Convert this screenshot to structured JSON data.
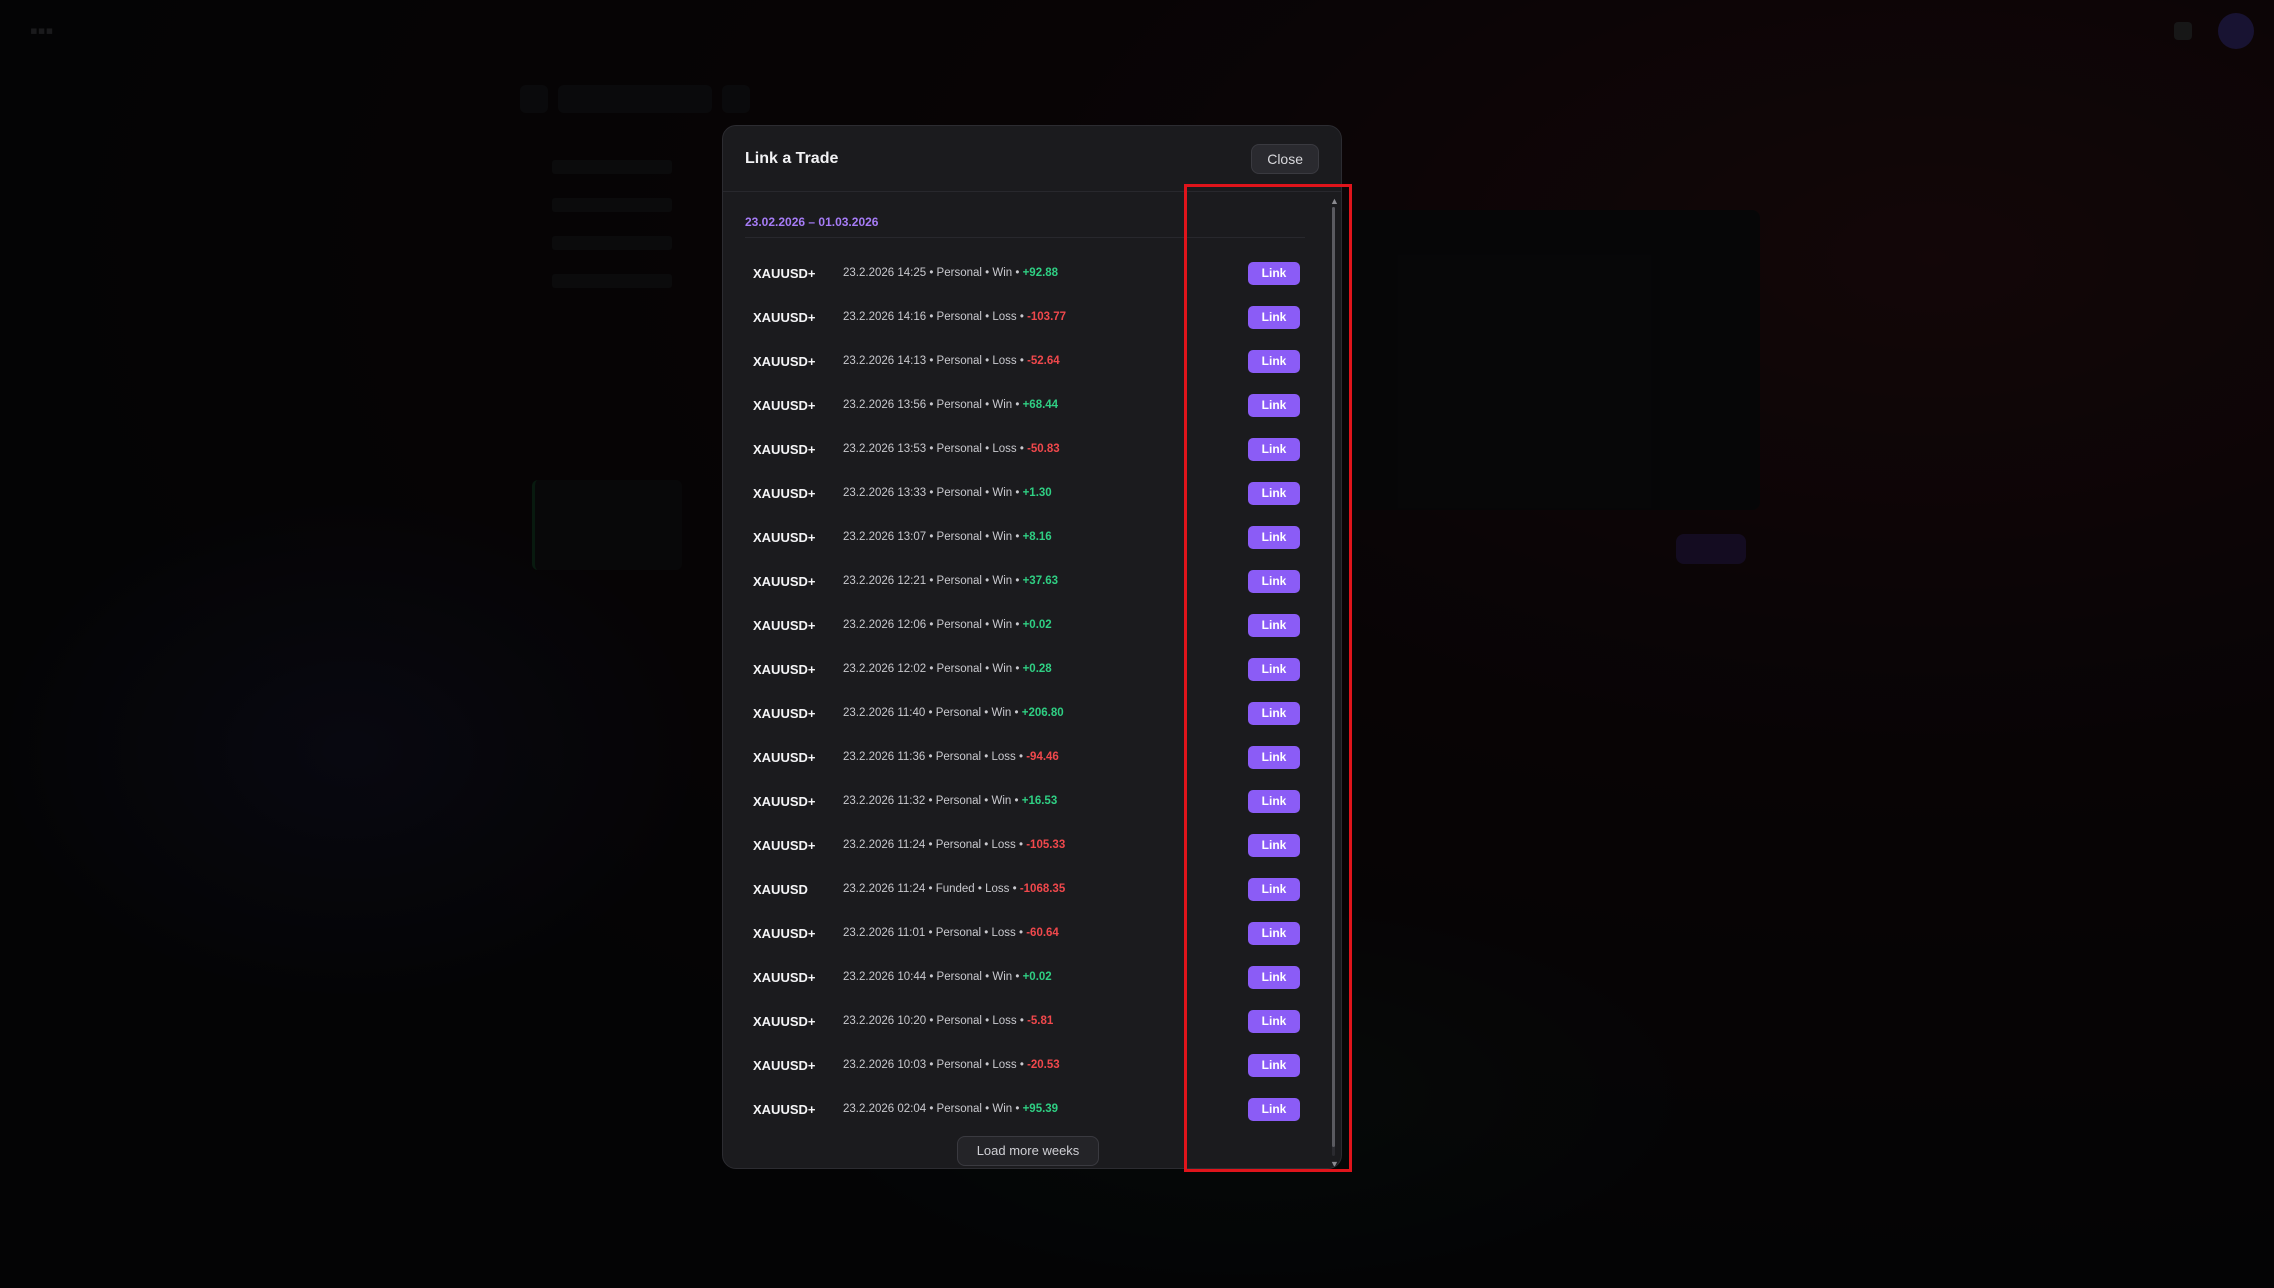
{
  "modal": {
    "title": "Link a Trade",
    "close_label": "Close",
    "week_range": "23.02.2026 – 01.03.2026",
    "link_label": "Link",
    "load_more_label": "Load more weeks"
  },
  "trades": [
    {
      "symbol": "XAUUSD+",
      "meta": "23.2.2026 14:25 • Personal • Win • ",
      "pnl": "+92.88",
      "result": "win"
    },
    {
      "symbol": "XAUUSD+",
      "meta": "23.2.2026 14:16 • Personal • Loss • ",
      "pnl": "-103.77",
      "result": "loss"
    },
    {
      "symbol": "XAUUSD+",
      "meta": "23.2.2026 14:13 • Personal • Loss • ",
      "pnl": "-52.64",
      "result": "loss"
    },
    {
      "symbol": "XAUUSD+",
      "meta": "23.2.2026 13:56 • Personal • Win • ",
      "pnl": "+68.44",
      "result": "win"
    },
    {
      "symbol": "XAUUSD+",
      "meta": "23.2.2026 13:53 • Personal • Loss • ",
      "pnl": "-50.83",
      "result": "loss"
    },
    {
      "symbol": "XAUUSD+",
      "meta": "23.2.2026 13:33 • Personal • Win • ",
      "pnl": "+1.30",
      "result": "win"
    },
    {
      "symbol": "XAUUSD+",
      "meta": "23.2.2026 13:07 • Personal • Win • ",
      "pnl": "+8.16",
      "result": "win"
    },
    {
      "symbol": "XAUUSD+",
      "meta": "23.2.2026 12:21 • Personal • Win • ",
      "pnl": "+37.63",
      "result": "win"
    },
    {
      "symbol": "XAUUSD+",
      "meta": "23.2.2026 12:06 • Personal • Win • ",
      "pnl": "+0.02",
      "result": "win"
    },
    {
      "symbol": "XAUUSD+",
      "meta": "23.2.2026 12:02 • Personal • Win • ",
      "pnl": "+0.28",
      "result": "win"
    },
    {
      "symbol": "XAUUSD+",
      "meta": "23.2.2026 11:40 • Personal • Win • ",
      "pnl": "+206.80",
      "result": "win"
    },
    {
      "symbol": "XAUUSD+",
      "meta": "23.2.2026 11:36 • Personal • Loss • ",
      "pnl": "-94.46",
      "result": "loss"
    },
    {
      "symbol": "XAUUSD+",
      "meta": "23.2.2026 11:32 • Personal • Win • ",
      "pnl": "+16.53",
      "result": "win"
    },
    {
      "symbol": "XAUUSD+",
      "meta": "23.2.2026 11:24 • Personal • Loss • ",
      "pnl": "-105.33",
      "result": "loss"
    },
    {
      "symbol": "XAUUSD",
      "meta": "23.2.2026 11:24 • Funded • Loss • ",
      "pnl": "-1068.35",
      "result": "loss"
    },
    {
      "symbol": "XAUUSD+",
      "meta": "23.2.2026 11:01 • Personal • Loss • ",
      "pnl": "-60.64",
      "result": "loss"
    },
    {
      "symbol": "XAUUSD+",
      "meta": "23.2.2026 10:44 • Personal • Win • ",
      "pnl": "+0.02",
      "result": "win"
    },
    {
      "symbol": "XAUUSD+",
      "meta": "23.2.2026 10:20 • Personal • Loss • ",
      "pnl": "-5.81",
      "result": "loss"
    },
    {
      "symbol": "XAUUSD+",
      "meta": "23.2.2026 10:03 • Personal • Loss • ",
      "pnl": "-20.53",
      "result": "loss"
    },
    {
      "symbol": "XAUUSD+",
      "meta": "23.2.2026 02:04 • Personal • Win • ",
      "pnl": "+95.39",
      "result": "win"
    }
  ],
  "colors": {
    "accent": "#8b5cf6",
    "week_range": "#a67cf6",
    "win": "#2fcf83",
    "loss": "#f0484c",
    "highlight": "#e0141b"
  },
  "icons": {
    "scroll_up": "chevron-up-icon",
    "scroll_down": "chevron-down-icon"
  }
}
